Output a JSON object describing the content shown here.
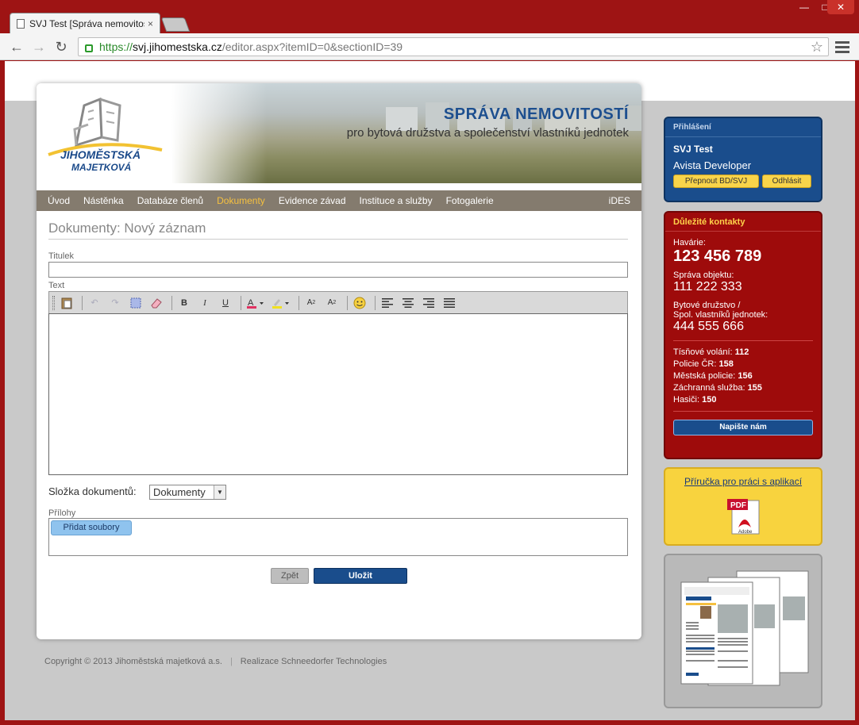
{
  "browser": {
    "tab_title": "SVJ Test [Správa nemovitosti",
    "tab_close": "×",
    "url_https": "https://",
    "url_host": "svj.jihomestska.cz",
    "url_path": "/editor.aspx?itemID=0&sectionID=39"
  },
  "logo": {
    "line1": "JIHOMĚSTSKÁ",
    "line2": "MAJETKOVÁ"
  },
  "banner": {
    "title": "SPRÁVA NEMOVITOSTÍ",
    "subtitle": "pro bytová družstva a společenství vlastníků jednotek"
  },
  "nav": {
    "items": [
      "Úvod",
      "Nástěnka",
      "Databáze členů",
      "Dokumenty",
      "Evidence závad",
      "Instituce a služby",
      "Fotogalerie"
    ],
    "active": "Dokumenty",
    "right": "iDES"
  },
  "form": {
    "page_title": "Dokumenty: Nový záznam",
    "title_label": "Titulek",
    "title_value": "",
    "text_label": "Text",
    "folder_label": "Složka dokumentů:",
    "folder_value": "Dokumenty",
    "attachments_label": "Přílohy",
    "add_files": "Přidat soubory",
    "back_button": "Zpět",
    "save_button": "Uložit"
  },
  "footer": {
    "copyright": "Copyright © 2013 Jihoměstská majetková a.s.",
    "realization": "Realizace Schneedorfer Technologies"
  },
  "login": {
    "header": "Přihlášení",
    "user": "SVJ Test",
    "org": "Avista Developer",
    "switch_button": "Přepnout BD/SVJ",
    "logout_button": "Odhlásit"
  },
  "contacts": {
    "header": "Důležité kontakty",
    "havarie_label": "Havárie:",
    "havarie_number": "123 456 789",
    "sprava_label": "Správa objektu:",
    "sprava_number": "111 222 333",
    "bd_label_1": "Bytové družstvo /",
    "bd_label_2": "Spol. vlastníků jednotek:",
    "bd_number": "444 555 666",
    "emergency": [
      {
        "label": "Tísňové volání:",
        "number": "112"
      },
      {
        "label": "Policie ČR:",
        "number": "158"
      },
      {
        "label": "Městská policie:",
        "number": "156"
      },
      {
        "label": "Záchranná služba:",
        "number": "155"
      },
      {
        "label": "Hasiči:",
        "number": "150"
      }
    ],
    "write_button": "Napište nám"
  },
  "guide": {
    "link": "Příručka pro práci s aplikací",
    "pdf_label": "PDF",
    "adobe_label": "Adobe"
  },
  "colors": {
    "brand_blue": "#1a4d8c",
    "brand_red": "#9e0b0b",
    "accent_yellow": "#f8d33e",
    "nav_bg": "#847b6e",
    "nav_active": "#f5c040"
  }
}
